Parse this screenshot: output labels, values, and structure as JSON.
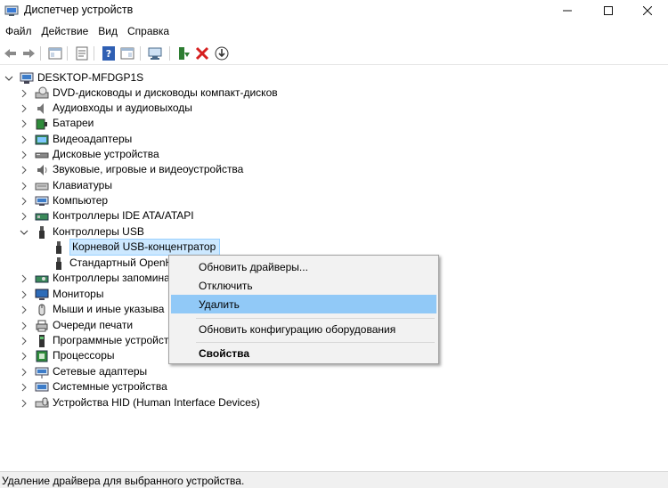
{
  "window": {
    "title": "Диспетчер устройств"
  },
  "menu": [
    "Файл",
    "Действие",
    "Вид",
    "Справка"
  ],
  "tree": {
    "root": "DESKTOP-MFDGP1S",
    "items": [
      "DVD-дисководы и дисководы компакт-дисков",
      "Аудиовходы и аудиовыходы",
      "Батареи",
      "Видеоадаптеры",
      "Дисковые устройства",
      "Звуковые, игровые и видеоустройства",
      "Клавиатуры",
      "Компьютер",
      "Контроллеры IDE ATA/ATAPI",
      "Контроллеры USB",
      "Корневой USB-концентратор",
      "Стандартный OpenH",
      "Контроллеры запомина",
      "Мониторы",
      "Мыши и иные указыва",
      "Очереди печати",
      "Программные устройст",
      "Процессоры",
      "Сетевые адаптеры",
      "Системные устройства",
      "Устройства HID (Human Interface Devices)"
    ]
  },
  "context_menu": {
    "items": [
      "Обновить драйверы...",
      "Отключить",
      "Удалить",
      "Обновить конфигурацию оборудования",
      "Свойства"
    ]
  },
  "status": {
    "text": "Удаление драйвера для выбранного устройства."
  },
  "colors": {
    "selection": "#cce8ff",
    "menu_hover": "#91c9f7",
    "status_bg": "#f0f0f0"
  }
}
